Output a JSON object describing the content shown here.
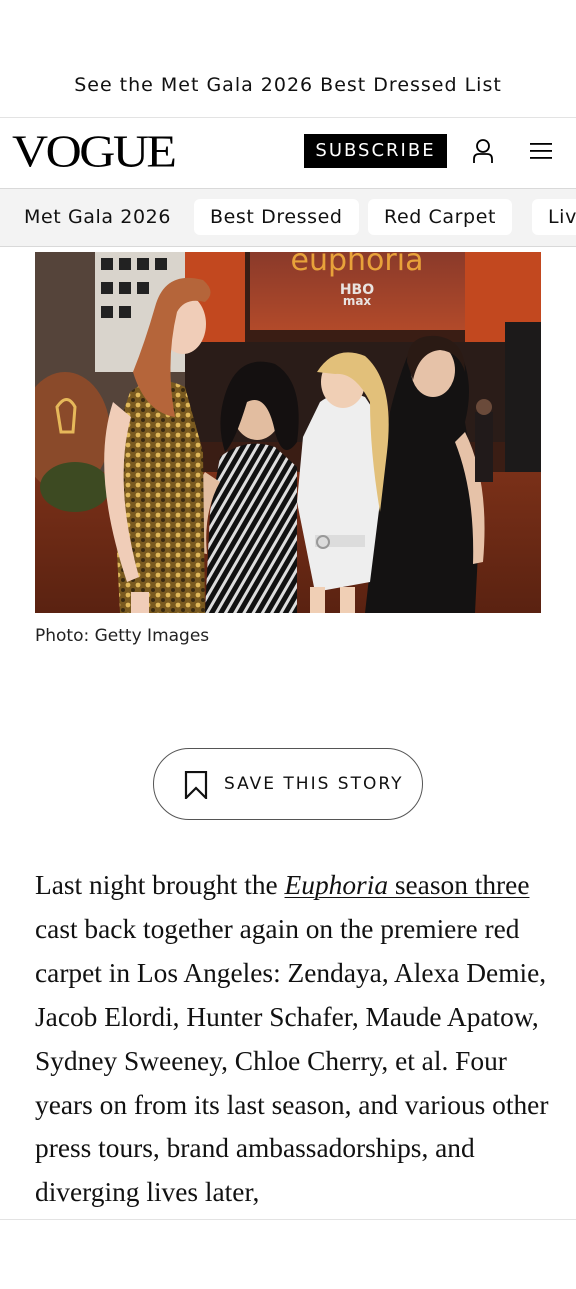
{
  "promo": {
    "text": "See the Met Gala 2026 Best Dressed List"
  },
  "header": {
    "logo": "VOGUE",
    "subscribe_label": "SUBSCRIBE",
    "account_icon": "user-icon",
    "menu_icon": "hamburger-menu-icon"
  },
  "nav": {
    "items": [
      {
        "label": "Met Gala 2026"
      },
      {
        "label": "Best Dressed"
      },
      {
        "label": "Red Carpet"
      },
      {
        "label": "Live"
      }
    ]
  },
  "photo": {
    "sign_text": "euphoria",
    "sign_brand_1": "HBO",
    "sign_brand_2": "max",
    "caption": "Photo: Getty Images"
  },
  "save": {
    "label": "SAVE THIS STORY",
    "icon": "bookmark-icon"
  },
  "article": {
    "p1_start": "Last night brought the ",
    "link_italic": "Euphoria",
    "link_rest": " season three",
    "p1_rest": " cast back together again on the premiere red carpet in Los Angeles: Zendaya, Alexa Demie, Jacob Elordi, Hunter Schafer, Maude Apatow, Sydney Sweeney, Chloe Cherry, et al. Four years on from its last season, and various other press tours, brand ambassadorships, and diverging lives later,"
  },
  "colors": {
    "text": "#111111",
    "nav_bg": "#f3f3f3",
    "subscribe_bg": "#000000",
    "backdrop_orange": "#c2481f",
    "sign_text": "#e8a23a"
  }
}
